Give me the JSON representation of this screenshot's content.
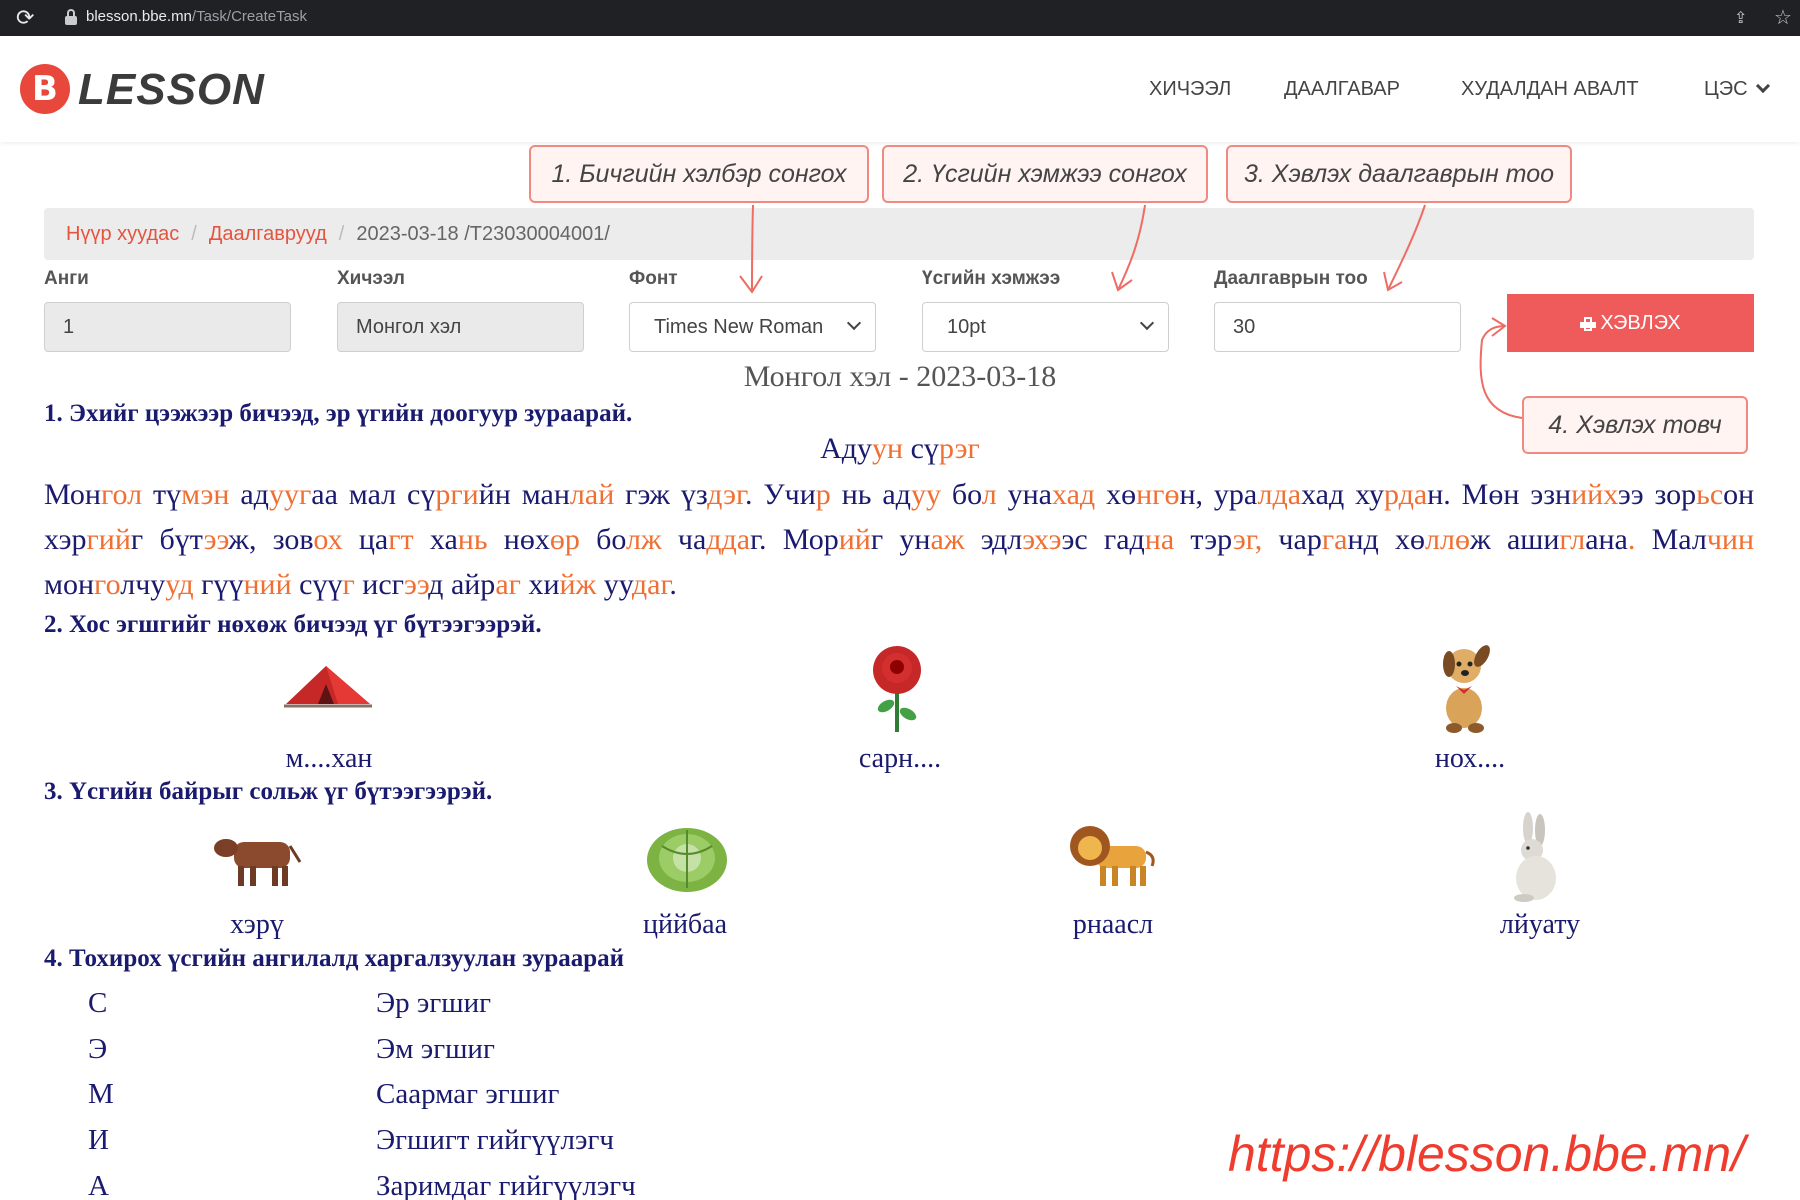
{
  "browser": {
    "url_host": "blesson.bbe.mn",
    "url_path": "/Task/CreateTask",
    "reload_icon": "reload-icon",
    "lock_icon": "lock-icon"
  },
  "header": {
    "logo_letter": "B",
    "logo_text": "LESSON",
    "nav": [
      "ХИЧЭЭЛ",
      "ДААЛГАВАР",
      "ХУДАЛДАН АВАЛТ",
      "ЦЭС"
    ]
  },
  "breadcrumb": {
    "home": "Нүүр хуудас",
    "tasks": "Даалгаврууд",
    "current": "2023-03-18 /T23030004001/"
  },
  "form": {
    "grade_label": "Анги",
    "grade_value": "1",
    "subject_label": "Хичээл",
    "subject_value": "Монгол хэл",
    "font_label": "Фонт",
    "font_value": "Times New Roman",
    "size_label": "Үсгийн хэмжээ",
    "size_value": "10pt",
    "count_label": "Даалгаврын тоо",
    "count_value": "30",
    "print_label": "ХЭВЛЭХ",
    "print_icon": "printer-icon"
  },
  "callouts": {
    "c1": "1. Бичгийн хэлбэр сонгох",
    "c2": "2. Үсгийн хэмжээ сонгох",
    "c3": "3. Хэвлэх даалгаврын тоо",
    "c4": "4. Хэвлэх товч"
  },
  "document": {
    "title": "Монгол хэл - 2023-03-18",
    "section1": {
      "heading": "1. Эхийг цээжээр бичээд, эр үгийн доогуур зураарай.",
      "story_title": "Адуун сүрэг",
      "story": "Монгол түмэн адуугаа мал сүргийн манлай гэж үздэг. Учир нь адуу бол унахад хөнгөн, уралдахад хурдан. Мөн эзнийхээ зорьсон хэргийг бүтээж, зовох цагт хань нөхөр болж чаддаг. Морийг унаж эдлэхээс гадна тэрэг, чарганд хөллөж ашиглана. Малчин монголчууд гүүний сүүг исгээд айраг хийж уудаг.",
      "story_highlight_color": "#f07033",
      "story_text_color": "#1a1a6e"
    },
    "section2": {
      "heading": "2. Хос эгшгийг нөхөж бичээд үг бүтээгээрэй.",
      "items": [
        {
          "icon": "tent-icon",
          "word": "м....хан"
        },
        {
          "icon": "rose-icon",
          "word": "сарн...."
        },
        {
          "icon": "dog-icon",
          "word": "нох...."
        }
      ]
    },
    "section3": {
      "heading": "3. Үсгийн байрыг сольж үг бүтээгээрэй.",
      "items": [
        {
          "icon": "cow-icon",
          "word": "хэрү"
        },
        {
          "icon": "cabbage-icon",
          "word": "цййбаа"
        },
        {
          "icon": "lion-icon",
          "word": "рнаасл"
        },
        {
          "icon": "rabbit-icon",
          "word": "лйуату"
        }
      ]
    },
    "section4": {
      "heading": "4. Тохирох үсгийн ангилалд харгалзуулан зураарай",
      "letters": [
        "С",
        "Э",
        "М",
        "И",
        "А"
      ],
      "categories": [
        "Эр эгшиг",
        "Эм эгшиг",
        "Саармаг эгшиг",
        "Эгшигт гийгүүлэгч",
        "Заримдаг гийгүүлэгч"
      ]
    }
  },
  "watermark": "https://blesson.bbe.mn/"
}
